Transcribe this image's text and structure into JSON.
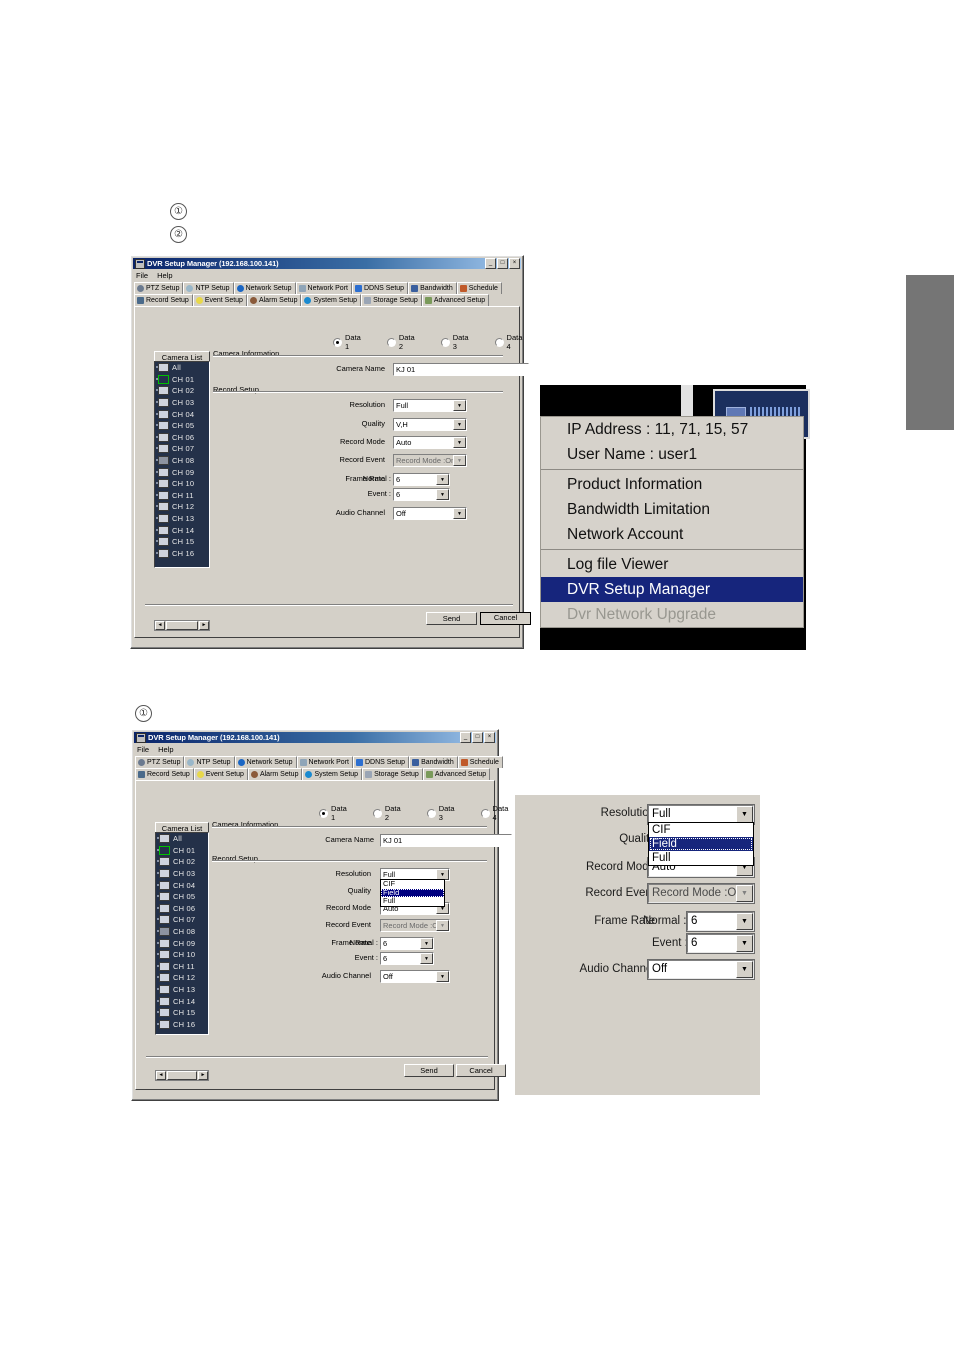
{
  "callouts": {
    "one": "①",
    "two": "②",
    "one_b": "①"
  },
  "window": {
    "title": "DVR Setup Manager (192.168.100.141)",
    "min_label": "_",
    "max_label": "□",
    "close_label": "×",
    "menus": [
      "File",
      "Help"
    ],
    "tabs_row1": [
      {
        "label": "PTZ Setup",
        "color": "#6b7a8f"
      },
      {
        "label": "NTP Setup",
        "color": "#9ab7c9"
      },
      {
        "label": "Network Setup",
        "color": "#1a66c4"
      },
      {
        "label": "Network Port",
        "color": "#8fa5b8"
      },
      {
        "label": "DDNS Setup",
        "color": "#2d6fd0"
      },
      {
        "label": "Bandwidth",
        "color": "#3a5f9e"
      },
      {
        "label": "Schedule",
        "color": "#c05a2a"
      }
    ],
    "tabs_row2": [
      {
        "label": "Record Setup",
        "color": "#4a6a8a",
        "selected": true
      },
      {
        "label": "Event Setup",
        "color": "#e8d84a",
        "selected": false
      },
      {
        "label": "Alarm Setup",
        "color": "#8a5a3a",
        "selected": false
      },
      {
        "label": "System Setup",
        "color": "#1a8ad0",
        "selected": false
      },
      {
        "label": "Storage Setup",
        "color": "#9aa5b5",
        "selected": false
      },
      {
        "label": "Advanced Setup",
        "color": "#7a9a5a",
        "selected": false
      }
    ],
    "data_radios": [
      {
        "label": "Data 1",
        "checked": true
      },
      {
        "label": "Data 2",
        "checked": false
      },
      {
        "label": "Data 3",
        "checked": false
      },
      {
        "label": "Data 4",
        "checked": false
      }
    ],
    "camera_list": {
      "header": "Camera List",
      "items": [
        {
          "label": "All",
          "state": "normal"
        },
        {
          "label": "CH 01",
          "state": "selected"
        },
        {
          "label": "CH 02",
          "state": "normal"
        },
        {
          "label": "CH 03",
          "state": "normal"
        },
        {
          "label": "CH 04",
          "state": "normal"
        },
        {
          "label": "CH 05",
          "state": "normal"
        },
        {
          "label": "CH 06",
          "state": "normal"
        },
        {
          "label": "CH 07",
          "state": "normal"
        },
        {
          "label": "CH 08",
          "state": "ptz"
        },
        {
          "label": "CH 09",
          "state": "normal"
        },
        {
          "label": "CH 10",
          "state": "normal"
        },
        {
          "label": "CH 11",
          "state": "normal"
        },
        {
          "label": "CH 12",
          "state": "normal"
        },
        {
          "label": "CH 13",
          "state": "normal"
        },
        {
          "label": "CH 14",
          "state": "normal"
        },
        {
          "label": "CH 15",
          "state": "normal"
        },
        {
          "label": "CH 16",
          "state": "normal"
        }
      ]
    },
    "groups": {
      "camera_information": "Camera Information",
      "record_setup": "Record Setup"
    },
    "fields": {
      "camera_name_label": "Camera Name",
      "camera_name_value": "KJ 01",
      "resolution_label": "Resolution",
      "resolution_value": "Full",
      "resolution_options": [
        "CIF",
        "Field",
        "Full"
      ],
      "resolution_highlighted": "Field",
      "quality_label": "Quality",
      "quality_value": "V,H",
      "record_mode_label": "Record Mode",
      "record_mode_value": "Auto",
      "record_event_label": "Record Event",
      "record_event_value": "Record Mode :On",
      "frame_rate_label": "Frame Rate",
      "frame_normal_label": "Normal :",
      "frame_normal_value": "6",
      "frame_event_label": "Event :",
      "frame_event_value": "6",
      "audio_channel_label": "Audio Channel",
      "audio_channel_value": "Off"
    },
    "buttons": {
      "send": "Send",
      "cancel": "Cancel"
    },
    "scroll": {
      "left": "◄",
      "right": "►"
    }
  },
  "context_menu": {
    "ip_address": "IP Address : 11, 71, 15, 57",
    "user_name": "User Name : user1",
    "items": [
      {
        "label": "Product Information",
        "state": "normal"
      },
      {
        "label": "Bandwidth Limitation",
        "state": "normal"
      },
      {
        "label": "Network Account",
        "state": "normal"
      },
      {
        "label": "Log file Viewer",
        "state": "normal"
      },
      {
        "label": "DVR Setup Manager",
        "state": "highlighted"
      },
      {
        "label": "Dvr Network Upgrade",
        "state": "disabled"
      }
    ]
  },
  "colors": {
    "dialog_face": "#d4d0c8",
    "title_blue": "#0a246a",
    "list_bg": "#243149",
    "highlight": "#16257c",
    "marker_gray": "#757575",
    "selected_green": "#00c000"
  }
}
